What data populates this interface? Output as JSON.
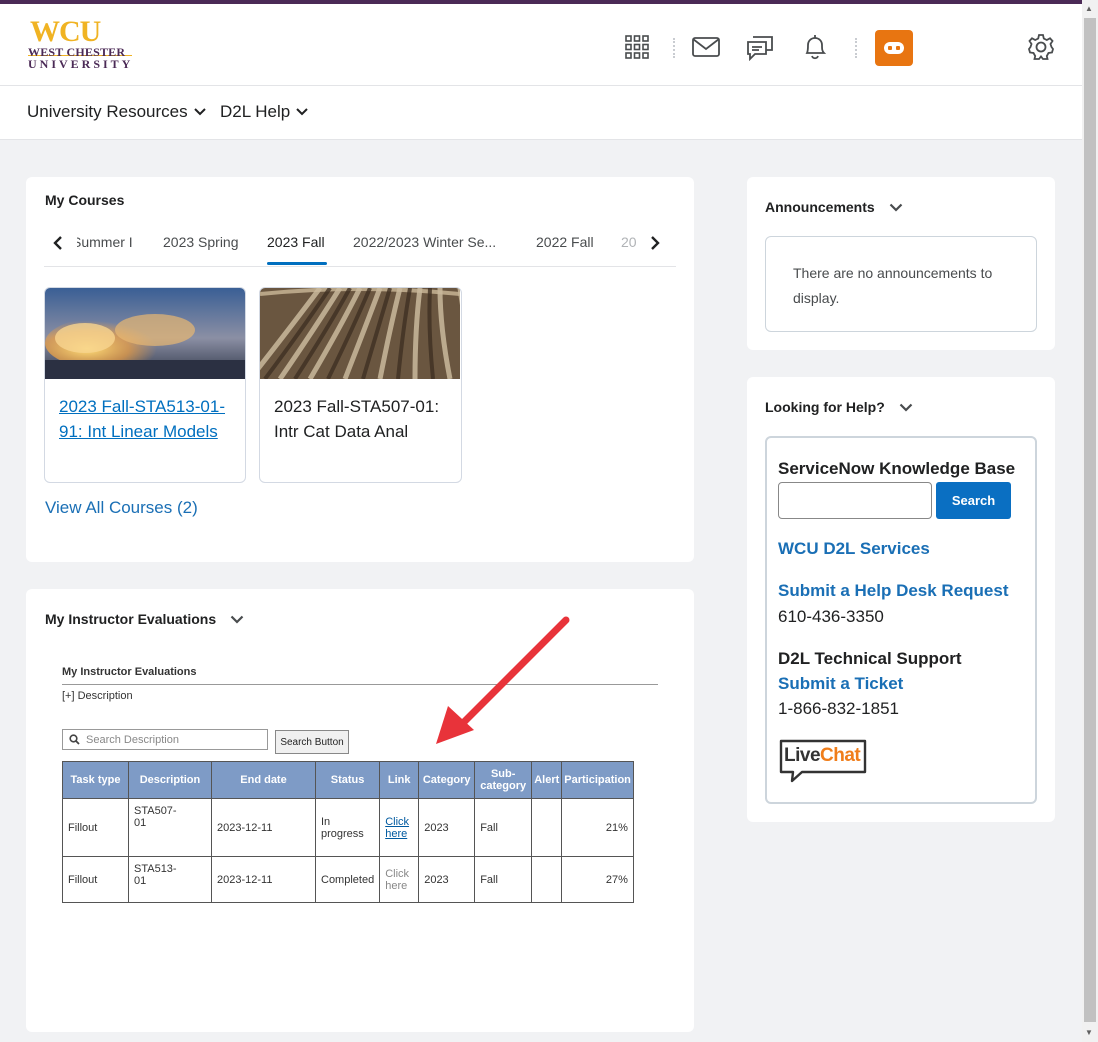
{
  "header": {
    "logo": {
      "big": "WCU",
      "line1": "WEST CHESTER",
      "line2": "UNIVERSITY"
    },
    "accent_color": "#4b2a56",
    "avatar_color": "#e87511"
  },
  "nav": {
    "items": [
      {
        "label": "University Resources"
      },
      {
        "label": "D2L Help"
      }
    ]
  },
  "my_courses": {
    "title": "My Courses",
    "tabs": [
      "Summer I",
      "2023 Spring",
      "2023 Fall",
      "2022/2023 Winter Se...",
      "2022 Fall",
      "20"
    ],
    "active_tab": "2023 Fall",
    "courses": [
      {
        "name": "2023 Fall-STA513-01-91: Int Linear Models",
        "linked": true
      },
      {
        "name": "2023 Fall-STA507-01: Intr Cat Data Anal",
        "linked": false
      }
    ],
    "view_all": "View All Courses (2)"
  },
  "evaluations": {
    "widget_title": "My Instructor Evaluations",
    "inner_title": "My Instructor Evaluations",
    "description_toggle": "[+] Description",
    "search_placeholder": "Search Description",
    "search_button": "Search Button",
    "columns": [
      "Task type",
      "Description",
      "End date",
      "Status",
      "Link",
      "Category",
      "Sub-category",
      "Alert",
      "Participation"
    ],
    "rows": [
      {
        "task_type": "Fillout",
        "description": "STA507-01",
        "end_date": "2023-12-11",
        "status": "In progress",
        "link": "Click here",
        "link_active": true,
        "category": "2023",
        "subcategory": "Fall",
        "alert": "",
        "participation": "21%"
      },
      {
        "task_type": "Fillout",
        "description": "STA513-01",
        "end_date": "2023-12-11",
        "status": "Completed",
        "link": "Click here",
        "link_active": false,
        "category": "2023",
        "subcategory": "Fall",
        "alert": "",
        "participation": "27%"
      }
    ]
  },
  "announcements": {
    "title": "Announcements",
    "empty_text": "There are no announcements to display."
  },
  "help": {
    "title": "Looking for Help?",
    "kb_title": "ServiceNow Knowledge Base",
    "kb_search": "Search",
    "services_link": "WCU D2L Services",
    "helpdesk_link": "Submit a Help Desk Request",
    "helpdesk_phone": "610-436-3350",
    "tech_support": "D2L Technical Support",
    "ticket_link": "Submit a Ticket",
    "tech_phone": "1-866-832-1851",
    "livechat": {
      "live": "Live",
      "chat": "Chat"
    }
  }
}
